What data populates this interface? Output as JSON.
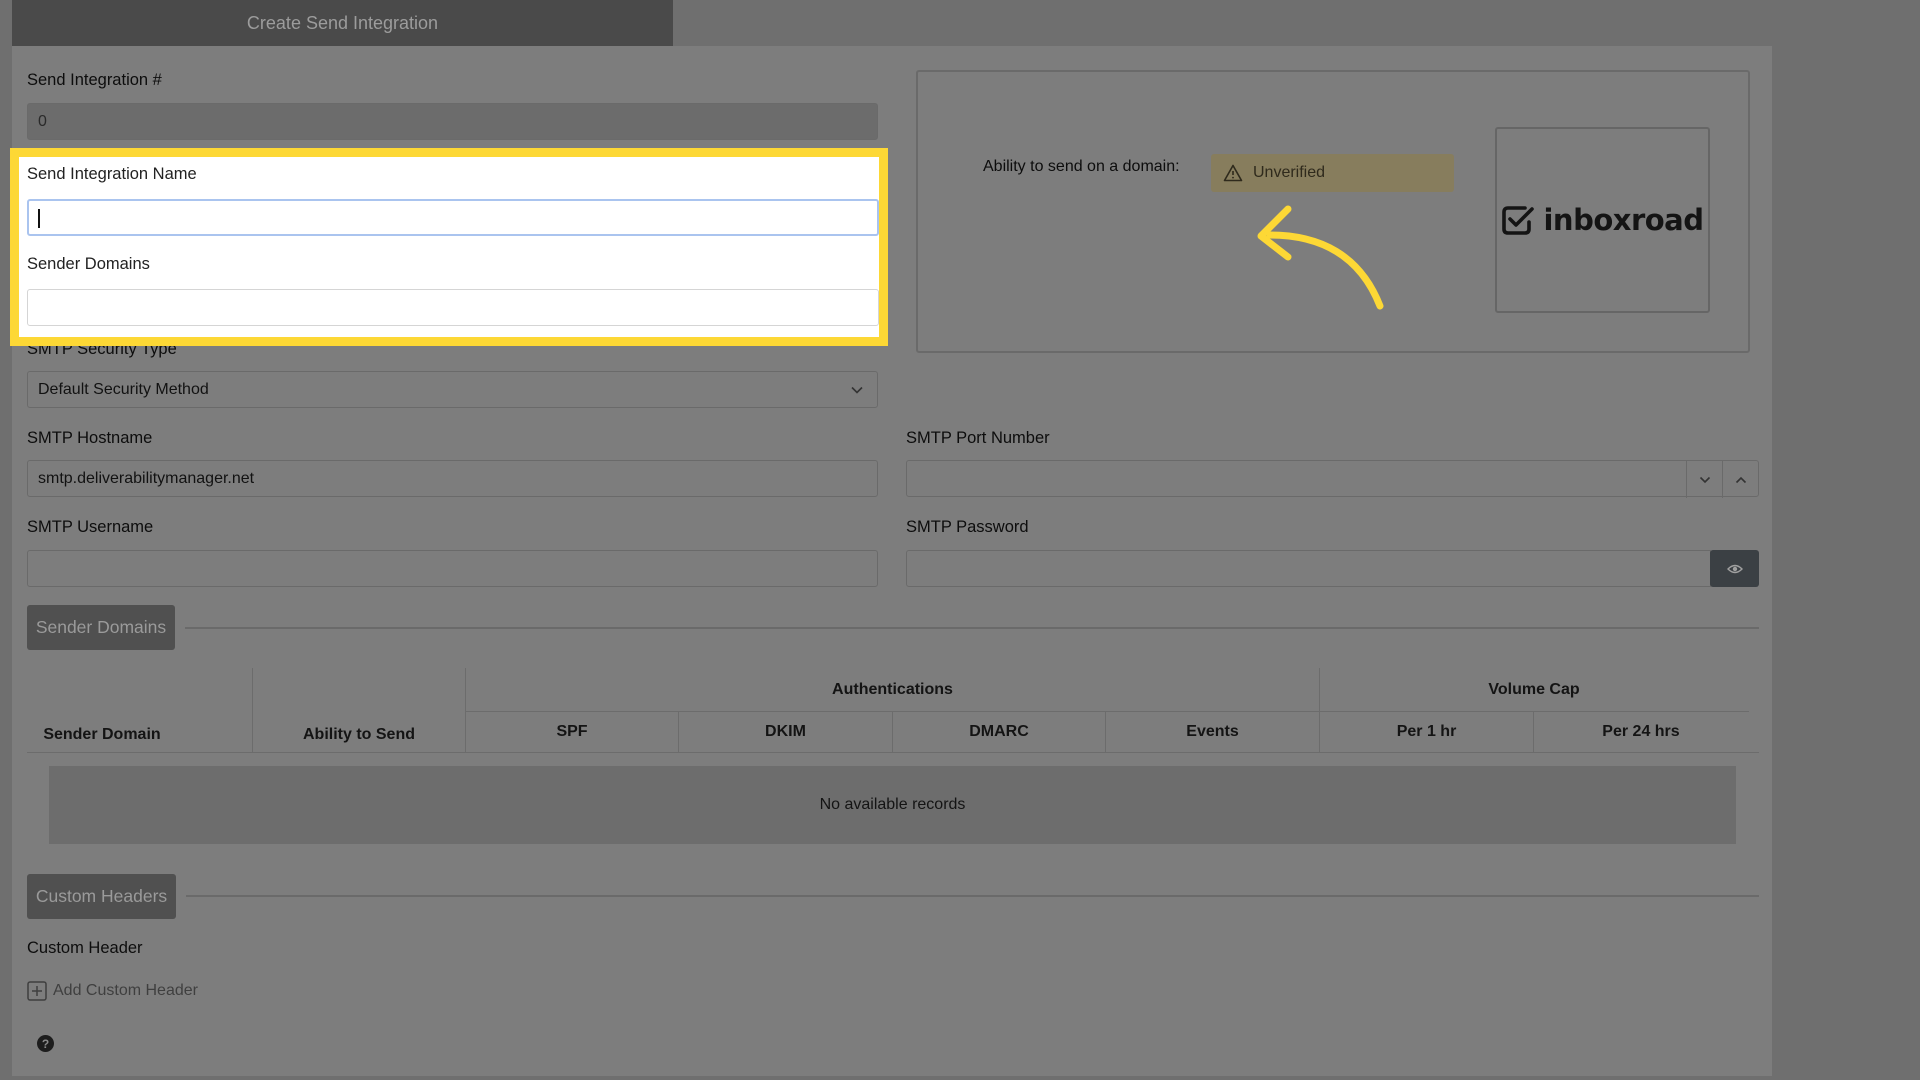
{
  "header": {
    "title": "Create Send Integration"
  },
  "form": {
    "integration_number_label": "Send Integration #",
    "integration_number_value": "0",
    "name_label": "Send Integration Name",
    "name_value": "",
    "sender_domains_label": "Sender Domains",
    "sender_domains_value": "",
    "security_type_label": "SMTP Security Type",
    "security_type_value": "Default Security Method",
    "hostname_label": "SMTP Hostname",
    "hostname_value": "smtp.deliverabilitymanager.net",
    "port_label": "SMTP Port Number",
    "port_value": "",
    "username_label": "SMTP Username",
    "username_value": "",
    "password_label": "SMTP Password",
    "password_value": ""
  },
  "domain_status": {
    "label": "Ability to send on a domain:",
    "badge": "Unverified",
    "badge_color": "#877d5d",
    "logo_text": "inboxroad"
  },
  "sender_domains_section": {
    "button": "Sender Domains",
    "table": {
      "group_headers": {
        "auth": "Authentications",
        "volume": "Volume Cap"
      },
      "columns": [
        "Sender Domain",
        "Ability to Send",
        "SPF",
        "DKIM",
        "DMARC",
        "Events",
        "Per 1 hr",
        "Per 24 hrs"
      ],
      "empty_text": "No available records"
    }
  },
  "custom_headers_section": {
    "button": "Custom Headers",
    "label": "Custom Header",
    "add_label": "Add Custom Header"
  },
  "help": {
    "glyph": "?"
  },
  "highlight_color": "#fdd835"
}
